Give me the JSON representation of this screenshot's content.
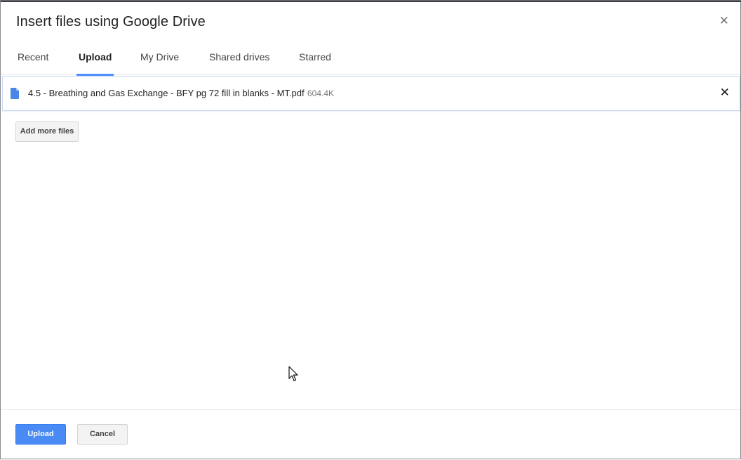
{
  "dialog": {
    "title": "Insert files using Google Drive",
    "close_icon": "close-icon"
  },
  "tabs": [
    {
      "label": "Recent",
      "active": false
    },
    {
      "label": "Upload",
      "active": true
    },
    {
      "label": "My Drive",
      "active": false
    },
    {
      "label": "Shared drives",
      "active": false
    },
    {
      "label": "Starred",
      "active": false
    }
  ],
  "files": [
    {
      "icon": "document-icon",
      "name": "4.5 - Breathing and Gas Exchange - BFY pg 72 fill in blanks - MT.pdf",
      "size": "604.4K"
    }
  ],
  "actions": {
    "add_more_label": "Add more files",
    "upload_label": "Upload",
    "cancel_label": "Cancel"
  },
  "colors": {
    "accent": "#4d90fe",
    "primary_button": "#4a8af4"
  }
}
